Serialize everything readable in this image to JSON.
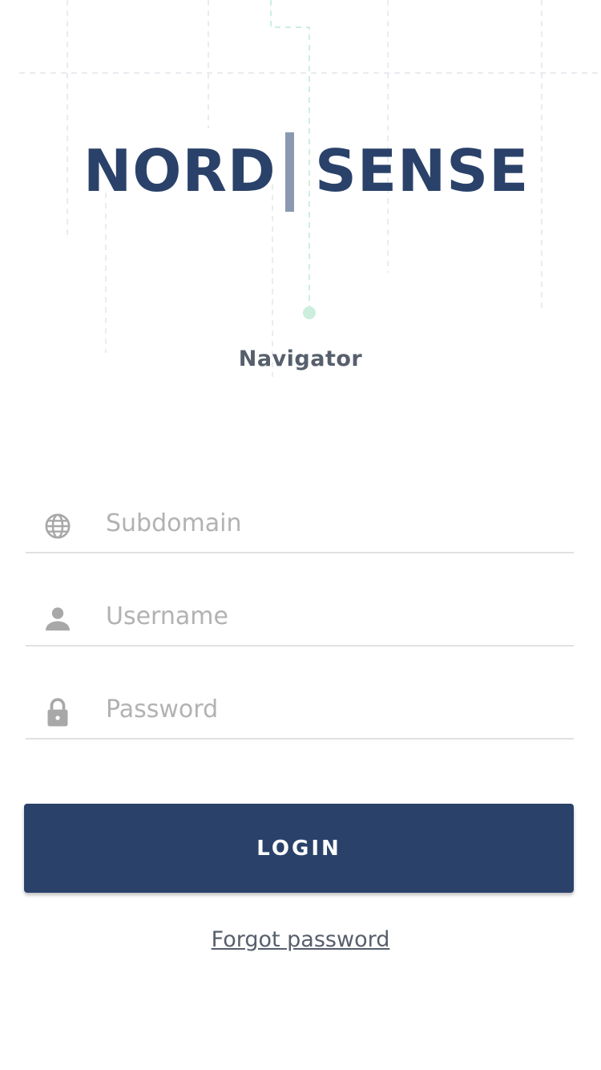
{
  "brand": {
    "name_left": "NORD",
    "name_right": "SENSE",
    "subtitle": "Navigator"
  },
  "form": {
    "subdomain": {
      "placeholder": "Subdomain",
      "value": "",
      "icon": "globe-icon"
    },
    "username": {
      "placeholder": "Username",
      "value": "",
      "icon": "person-icon"
    },
    "password": {
      "placeholder": "Password",
      "value": "",
      "icon": "lock-icon"
    }
  },
  "actions": {
    "login_label": "LOGIN",
    "forgot_label": "Forgot password"
  },
  "colors": {
    "brand_navy": "#2a426a",
    "divider": "#8b99b0",
    "accent_green": "#cbeedd",
    "text_gray": "#575f6c",
    "placeholder": "#b2b2b2",
    "icon_gray": "#a8a8a8"
  }
}
